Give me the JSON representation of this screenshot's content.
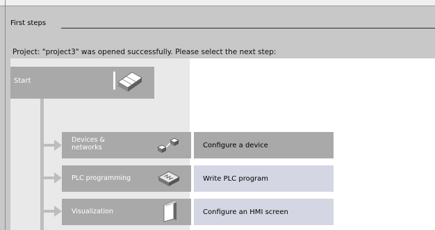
{
  "header": {
    "title": "First steps"
  },
  "project_message": "Project: \"project3\" was opened successfully. Please select the next step:",
  "start": {
    "label": "Start",
    "icon": "start-portal-icon"
  },
  "steps": [
    {
      "label": "Devices & networks",
      "label_line1": "Devices &",
      "label_line2": "networks",
      "icon": "devices-networks-icon",
      "description": "Configure a device"
    },
    {
      "label": "PLC programming",
      "icon": "plc-programming-icon",
      "description": "Write PLC program"
    },
    {
      "label": "Visualization",
      "icon": "visualization-icon",
      "description": "Configure an HMI screen"
    }
  ]
}
